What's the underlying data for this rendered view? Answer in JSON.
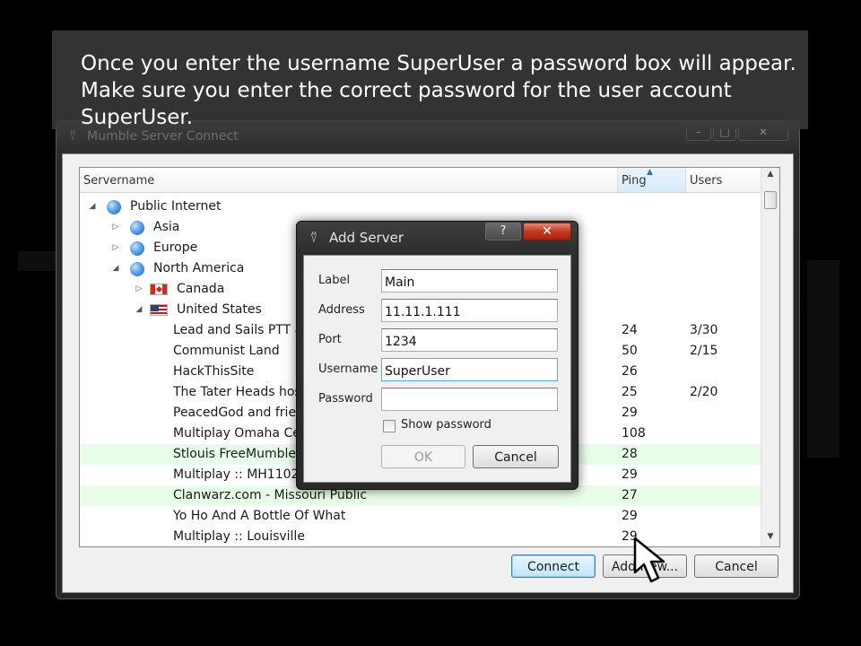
{
  "banner": {
    "text": "Once you enter the username SuperUser a password box will appear. Make sure you enter the correct password for the user account SuperUser."
  },
  "main_window": {
    "title": "Mumble Server Connect",
    "icon": "mumble-logo-icon",
    "columns": {
      "servername": "Servername",
      "ping": "Ping",
      "users": "Users"
    },
    "tree": [
      {
        "name": "Public Internet",
        "level": 0,
        "icon": "globe-icon",
        "expanded": true
      },
      {
        "name": "Asia",
        "level": 1,
        "icon": "globe-icon",
        "expanded": false
      },
      {
        "name": "Europe",
        "level": 1,
        "icon": "globe-icon",
        "expanded": false
      },
      {
        "name": "North America",
        "level": 1,
        "icon": "globe-icon",
        "expanded": true
      },
      {
        "name": "Canada",
        "level": 2,
        "icon": "canada-flag-icon",
        "expanded": false
      },
      {
        "name": "United States",
        "level": 2,
        "icon": "us-flag-icon",
        "expanded": true
      }
    ],
    "servers": [
      {
        "name": "Lead and Sails PTT a",
        "ping": "24",
        "users": "3/30",
        "highlighted": false
      },
      {
        "name": "Communist Land",
        "ping": "50",
        "users": "2/15",
        "highlighted": false
      },
      {
        "name": "HackThisSite",
        "ping": "26",
        "users": "",
        "highlighted": false
      },
      {
        "name": "The Tater Heads host",
        "ping": "25",
        "users": "2/20",
        "highlighted": false
      },
      {
        "name": "PeacedGod and frien",
        "ping": "29",
        "users": "",
        "highlighted": false
      },
      {
        "name": "Multiplay Omaha Ce",
        "ping": "108",
        "users": "",
        "highlighted": false
      },
      {
        "name": "Stlouis FreeMumble.",
        "ping": "28",
        "users": "",
        "highlighted": true
      },
      {
        "name": "Multiplay :: MH11028",
        "ping": "29",
        "users": "",
        "highlighted": false
      },
      {
        "name": "Clanwarz.com - Missouri Public",
        "ping": "27",
        "users": "",
        "highlighted": true
      },
      {
        "name": "Yo Ho And A Bottle Of What",
        "ping": "29",
        "users": "",
        "highlighted": false
      },
      {
        "name": "Multiplay :: Louisville",
        "ping": "29",
        "users": "",
        "highlighted": false
      }
    ],
    "buttons": {
      "connect": "Connect",
      "add_new": "Add New...",
      "cancel": "Cancel"
    }
  },
  "dialog": {
    "title": "Add Server",
    "icon": "mumble-logo-icon",
    "help_label": "?",
    "close_label": "✕",
    "fields": {
      "label": {
        "label": "Label",
        "value": "Main"
      },
      "address": {
        "label": "Address",
        "value": "11.11.1.111"
      },
      "port": {
        "label": "Port",
        "value": "1234"
      },
      "username": {
        "label": "Username",
        "value": "SuperUser"
      },
      "password": {
        "label": "Password",
        "value": ""
      }
    },
    "show_password": {
      "label": "Show password",
      "checked": false
    },
    "ok_label": "OK",
    "cancel_label": "Cancel"
  }
}
